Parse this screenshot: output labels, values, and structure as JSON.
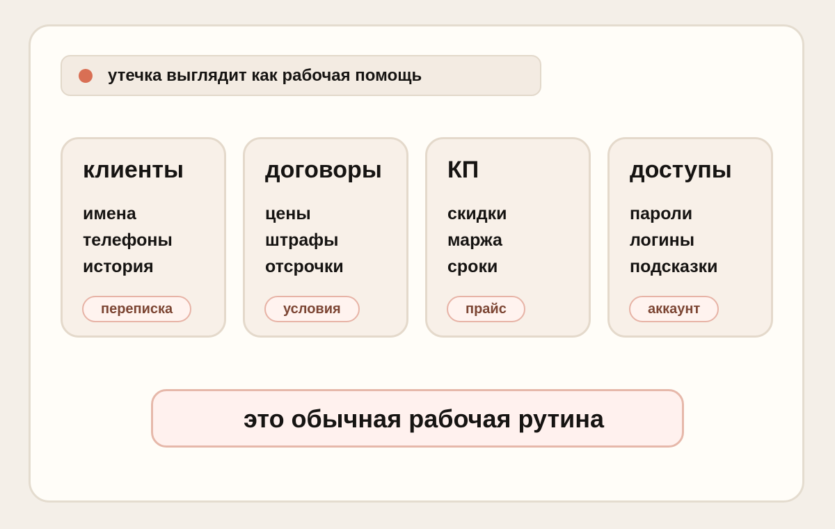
{
  "banner": {
    "text": "утечка выглядит как рабочая помощь",
    "dot_color": "#d96f54"
  },
  "cards": [
    {
      "title": "клиенты",
      "items": [
        "имена",
        "телефоны",
        "история"
      ],
      "tag": "переписка"
    },
    {
      "title": "договоры",
      "items": [
        "цены",
        "штрафы",
        "отсрочки"
      ],
      "tag": "условия"
    },
    {
      "title": "КП",
      "items": [
        "скидки",
        "маржа",
        "сроки"
      ],
      "tag": "прайс"
    },
    {
      "title": "доступы",
      "items": [
        "пароли",
        "логины",
        "подсказки"
      ],
      "tag": "аккаунт"
    }
  ],
  "footer": {
    "text": "это обычная рабочая рутина"
  },
  "colors": {
    "accent": "#d96f54",
    "tag_text": "#7c4533",
    "tag_border": "#e7b3a6",
    "card_bg": "#f8f0e8",
    "page_bg": "#f4efe8"
  }
}
